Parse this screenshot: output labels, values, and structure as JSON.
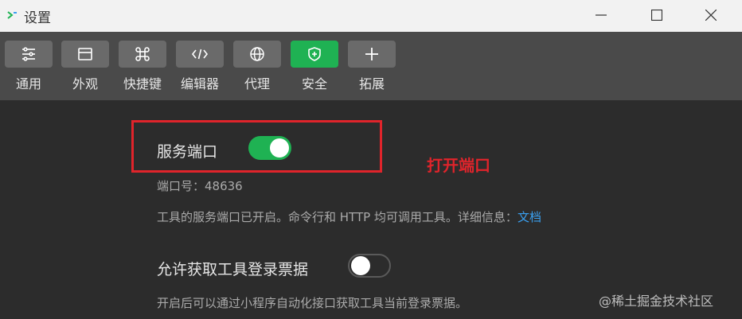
{
  "window": {
    "title": "设置"
  },
  "toolbar": {
    "items": [
      {
        "label": "通用",
        "icon": "sliders-icon"
      },
      {
        "label": "外观",
        "icon": "window-icon"
      },
      {
        "label": "快捷键",
        "icon": "command-icon"
      },
      {
        "label": "编辑器",
        "icon": "code-icon"
      },
      {
        "label": "代理",
        "icon": "globe-icon"
      },
      {
        "label": "安全",
        "icon": "shield-icon",
        "active": true
      },
      {
        "label": "拓展",
        "icon": "plus-icon"
      }
    ],
    "active_color": "#1fb253"
  },
  "security": {
    "service_port": {
      "label": "服务端口",
      "enabled": true,
      "port_text": "端口号：48636",
      "description": "工具的服务端口已开启。命令行和 HTTP 均可调用工具。详细信息：",
      "doc_link": "文档"
    },
    "login_ticket": {
      "label": "允许获取工具登录票据",
      "enabled": false,
      "description": "开启后可以通过小程序自动化接口获取工具当前登录票据。"
    }
  },
  "annotation": {
    "text": "打开端口",
    "color": "#e0242b"
  },
  "watermark": "@稀土掘金技术社区"
}
